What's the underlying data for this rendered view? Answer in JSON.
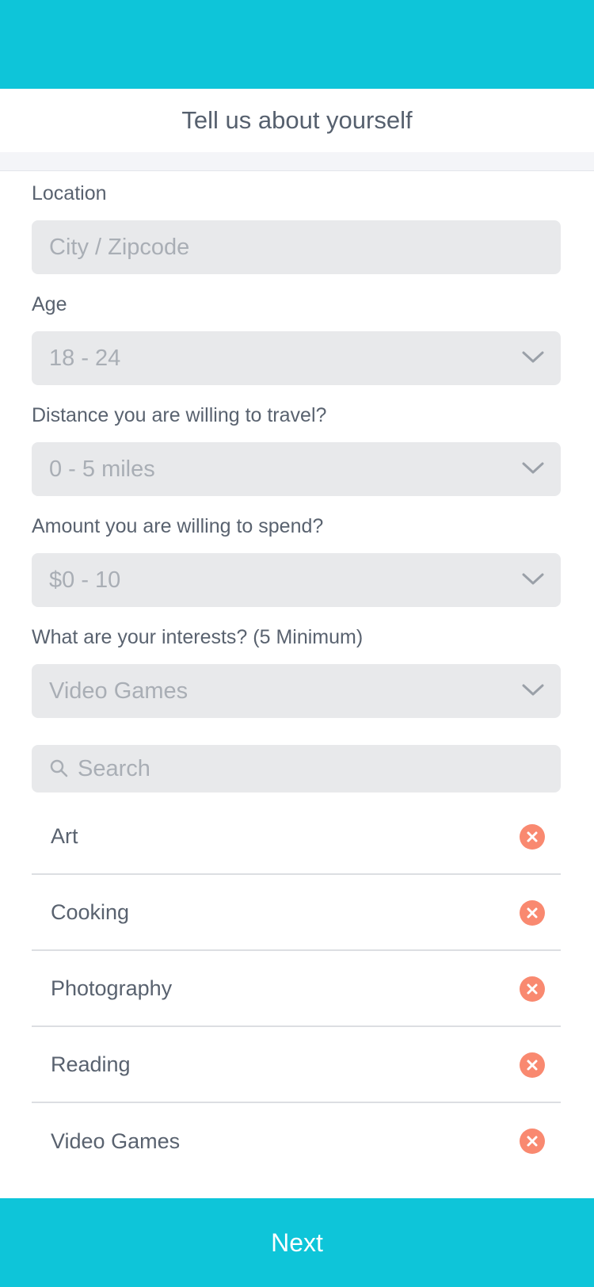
{
  "header": {
    "title": "Tell us about yourself"
  },
  "location": {
    "label": "Location",
    "placeholder": "City / Zipcode"
  },
  "age": {
    "label": "Age",
    "value": "18 - 24"
  },
  "distance": {
    "label": "Distance you are willing to travel?",
    "value": "0 - 5 miles"
  },
  "amount": {
    "label": "Amount you are willing to spend?",
    "value": "$0 - 10"
  },
  "interests": {
    "label": "What are your interests? (5 Minimum)",
    "value": "Video Games",
    "search_placeholder": "Search",
    "items": [
      {
        "label": "Art"
      },
      {
        "label": "Cooking"
      },
      {
        "label": "Photography"
      },
      {
        "label": "Reading"
      },
      {
        "label": "Video Games"
      }
    ]
  },
  "footer": {
    "next_label": "Next"
  },
  "colors": {
    "accent": "#0ec5d9",
    "remove": "#f98970",
    "field_bg": "#e8e9eb"
  },
  "icons": {
    "dropdown": "chevron-down-icon",
    "search": "search-icon",
    "remove": "close-circle-icon"
  }
}
